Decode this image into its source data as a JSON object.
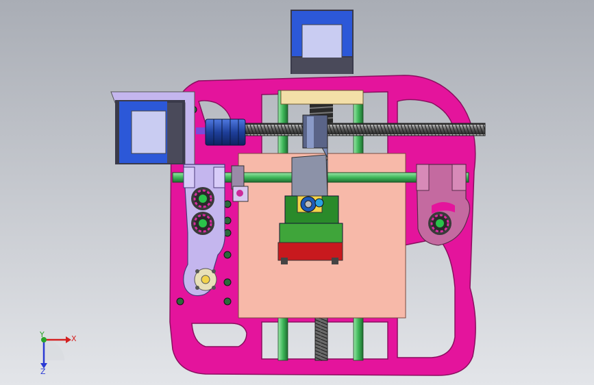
{
  "viewport": {
    "background_top": "#a9adb5",
    "background_bottom": "#e3e5e9"
  },
  "colors": {
    "frame": "#e4149c",
    "frame_edge": "#8a0f5f",
    "rod": "#3fb85a",
    "screw": "#5a5a5a",
    "plate": "#f7b9a9",
    "motor_blue": "#2c58d8",
    "motor_face": "#c9ccf2",
    "motor_dark": "#3a3a4a",
    "coupler": "#1e3f9a",
    "carriage": "#3fa53a",
    "carriage_base": "#c8191e",
    "lavender": "#c4b6ee",
    "mauve": "#c46aa0",
    "nut_gray": "#8c92a8",
    "spring": "#2a2a2a",
    "bracket_yellow": "#f3dfa8"
  },
  "icons": {
    "coordinate_triad": "xyz-triad-icon"
  },
  "triad": {
    "x_label": "X",
    "y_label": "Y",
    "z_label": "Z",
    "x_color": "#d42020",
    "y_color": "#2aa52a",
    "z_color": "#2a3ad4"
  }
}
